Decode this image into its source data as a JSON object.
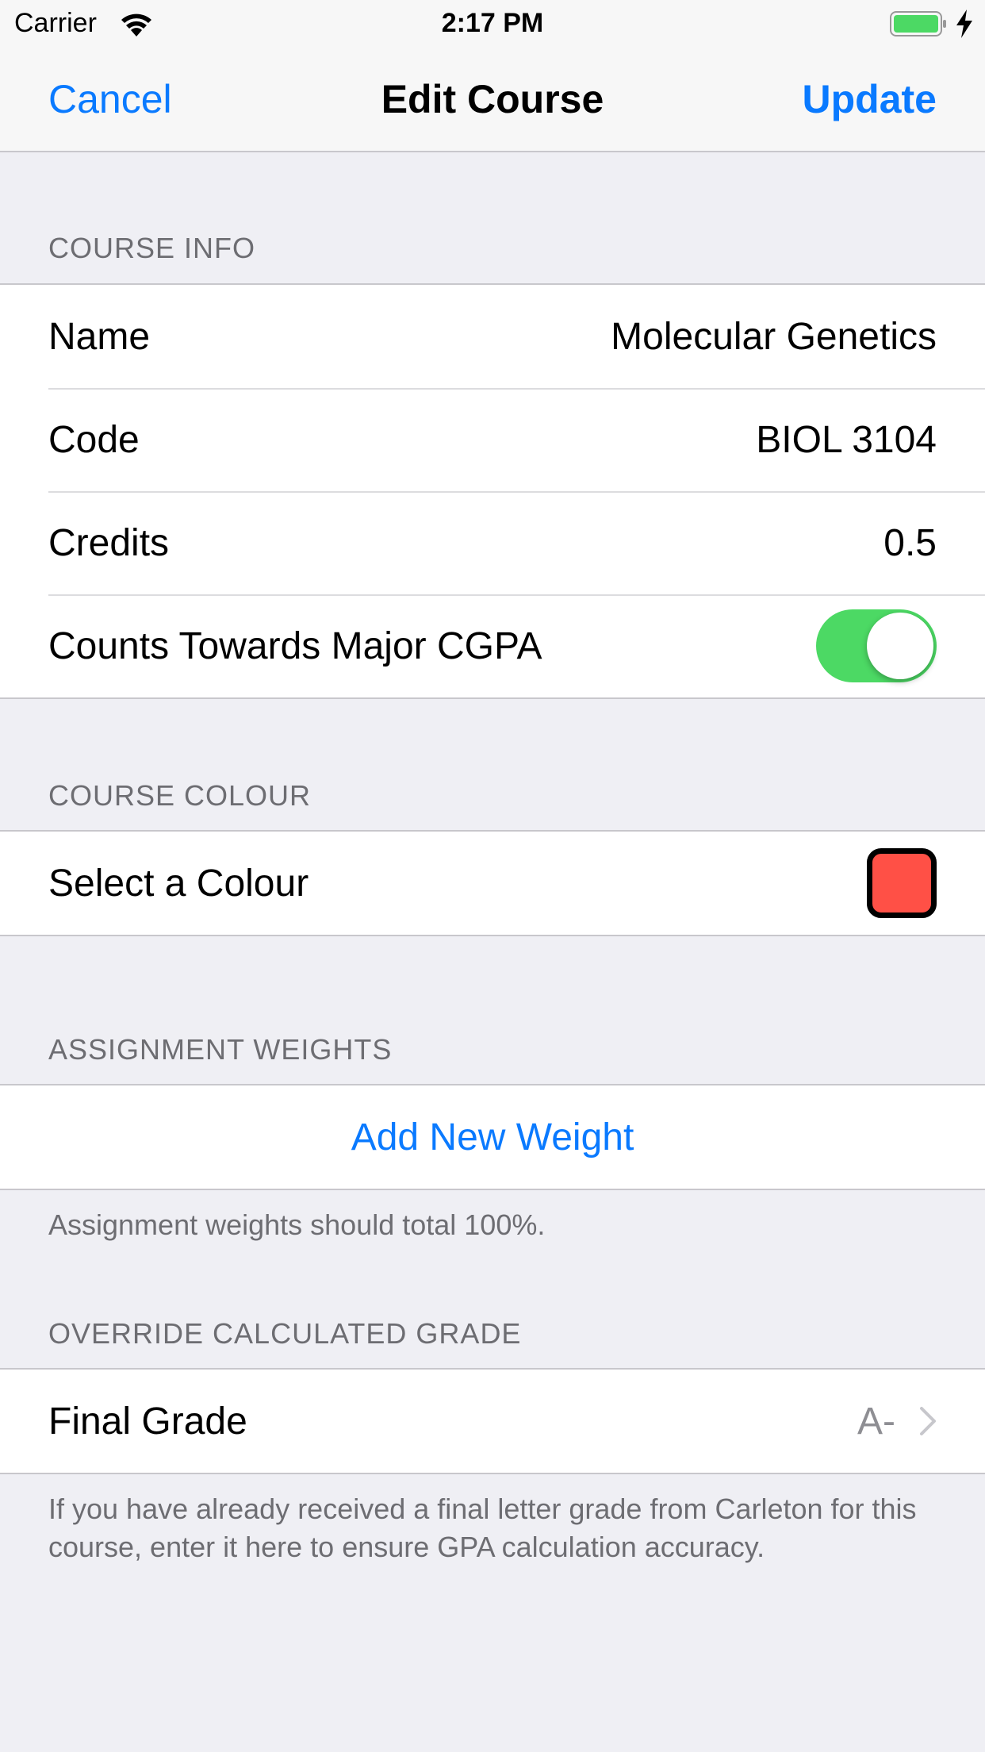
{
  "status_bar": {
    "carrier": "Carrier",
    "time": "2:17 PM",
    "battery_color": "#4cd964"
  },
  "nav": {
    "cancel_label": "Cancel",
    "title": "Edit Course",
    "update_label": "Update",
    "accent": "#0a7aff"
  },
  "course_info": {
    "header": "COURSE INFO",
    "name_label": "Name",
    "name_value": "Molecular Genetics",
    "code_label": "Code",
    "code_value": "BIOL 3104",
    "credits_label": "Credits",
    "credits_value": "0.5",
    "major_label": "Counts Towards Major CGPA",
    "major_on": true
  },
  "course_colour": {
    "header": "COURSE COLOUR",
    "select_label": "Select a Colour",
    "selected_color": "#ff5046"
  },
  "assignment_weights": {
    "header": "ASSIGNMENT WEIGHTS",
    "add_label": "Add New Weight",
    "footer": "Assignment weights should total 100%."
  },
  "override": {
    "header": "OVERRIDE CALCULATED GRADE",
    "final_label": "Final Grade",
    "final_value": "A-",
    "footer": "If you have already received a final letter grade from Carleton for this course, enter it here to ensure GPA calculation accuracy."
  }
}
